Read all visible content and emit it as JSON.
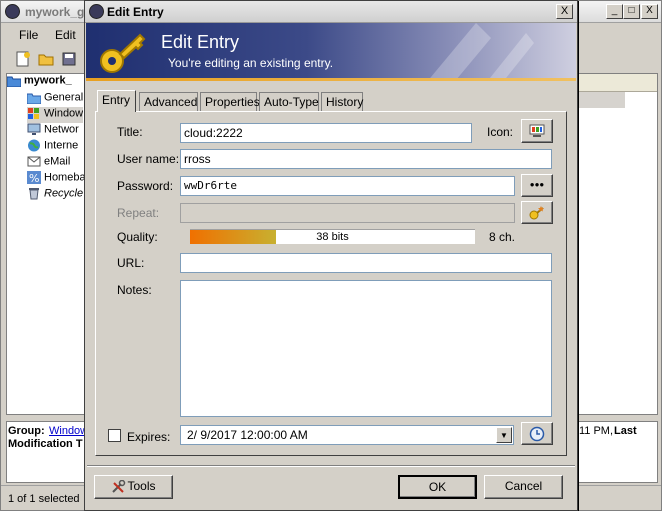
{
  "background_window": {
    "title": "mywork_g",
    "controls": {
      "minimize": "_",
      "maximize": "□",
      "close": "X"
    },
    "menu": [
      "File",
      "Edit"
    ],
    "tree": [
      {
        "label": "mywork_",
        "bold": true
      },
      {
        "label": "General"
      },
      {
        "label": "Window"
      },
      {
        "label": "Networ"
      },
      {
        "label": "Interne"
      },
      {
        "label": "eMail"
      },
      {
        "label": "Homeba"
      },
      {
        "label": "Recycle",
        "italic": true
      }
    ],
    "info": {
      "group_label": "Group:",
      "group_value": "Window",
      "modification_label": "Modification T",
      "right_text": "11 PM,",
      "last_label": "Last"
    },
    "status": "1 of 1 selected"
  },
  "dialog": {
    "title": "Edit Entry",
    "close": "X",
    "banner": {
      "title": "Edit Entry",
      "subtitle": "You're editing an existing entry."
    },
    "tabs": [
      {
        "label": "Entry",
        "active": true
      },
      {
        "label": "Advanced"
      },
      {
        "label": "Properties"
      },
      {
        "label": "Auto-Type"
      },
      {
        "label": "History"
      }
    ],
    "form": {
      "title_label": "Title:",
      "title_value": "cloud:2222",
      "icon_label": "Icon:",
      "username_label": "User name:",
      "username_value": "rross",
      "password_label": "Password:",
      "password_value": "wwDr6rte",
      "password_toggle": "●●●",
      "repeat_label": "Repeat:",
      "repeat_value": "",
      "quality_label": "Quality:",
      "quality_text": "38 bits",
      "quality_fraction": 0.3,
      "quality_chars": "8 ch.",
      "url_label": "URL:",
      "url_value": "",
      "notes_label": "Notes:",
      "notes_value": "",
      "expires_label": "Expires:",
      "expires_checked": false,
      "expires_value": "2/  9/2017 12:00:00 AM"
    },
    "buttons": {
      "tools": "Tools",
      "ok": "OK",
      "cancel": "Cancel"
    }
  }
}
